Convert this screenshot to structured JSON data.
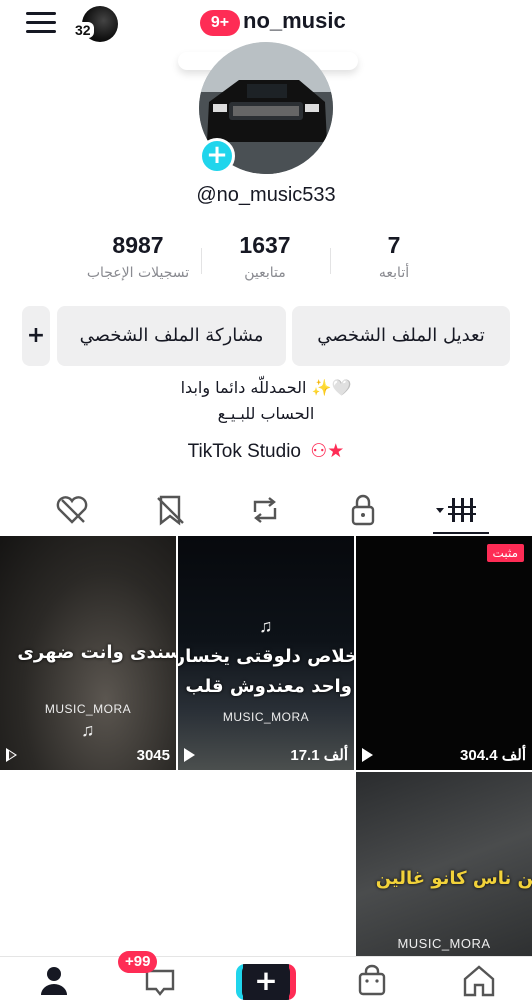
{
  "header": {
    "story_count": "32",
    "notifications_badge": "9+",
    "username": "no_music"
  },
  "profile": {
    "handle": "@no_music533",
    "stats": [
      {
        "value": "8987",
        "label": "تسجيلات الإعجاب"
      },
      {
        "value": "1637",
        "label": "متابعين"
      },
      {
        "value": "7",
        "label": "أتابعه"
      }
    ],
    "buttons": {
      "add_friend": "+",
      "share_profile": "مشاركة الملف الشخصي",
      "edit_profile": "تعديل الملف الشخصي"
    },
    "bio_line1": "الحمدللّه دائما وابدا ✨🤍",
    "bio_line2": "الحساب للبـيـع",
    "studio_link": "TikTok Studio"
  },
  "tabs": [
    {
      "icon": "liked-hidden-icon"
    },
    {
      "icon": "favorites-hidden-icon"
    },
    {
      "icon": "repost-icon"
    },
    {
      "icon": "private-lock-icon"
    },
    {
      "icon": "videos-grid-icon",
      "active": true
    }
  ],
  "videos": [
    {
      "caption": "سندى وانت ضهرى",
      "watermark": "MUSIC_MORA",
      "note": "♫",
      "views": "3045"
    },
    {
      "caption_line1": "خلاص دلوقتى يخسارت",
      "caption_line2": "بت واحد معندوش قلب",
      "watermark": "MUSIC_MORA",
      "note": "♫",
      "views": "17.1 ألف"
    },
    {
      "pinned_label": "مثبت",
      "views": "304.4 ألف"
    },
    {
      "caption": "بنا من ناس كانو غالين",
      "watermark": "MUSIC_MORA"
    }
  ],
  "bottom_nav": {
    "inbox_badge": "+99",
    "create_label": "+"
  },
  "colors": {
    "accent_red": "#fe2c55",
    "accent_cyan": "#20d5ec",
    "text_primary": "#161823",
    "text_secondary": "#8a8b91"
  }
}
